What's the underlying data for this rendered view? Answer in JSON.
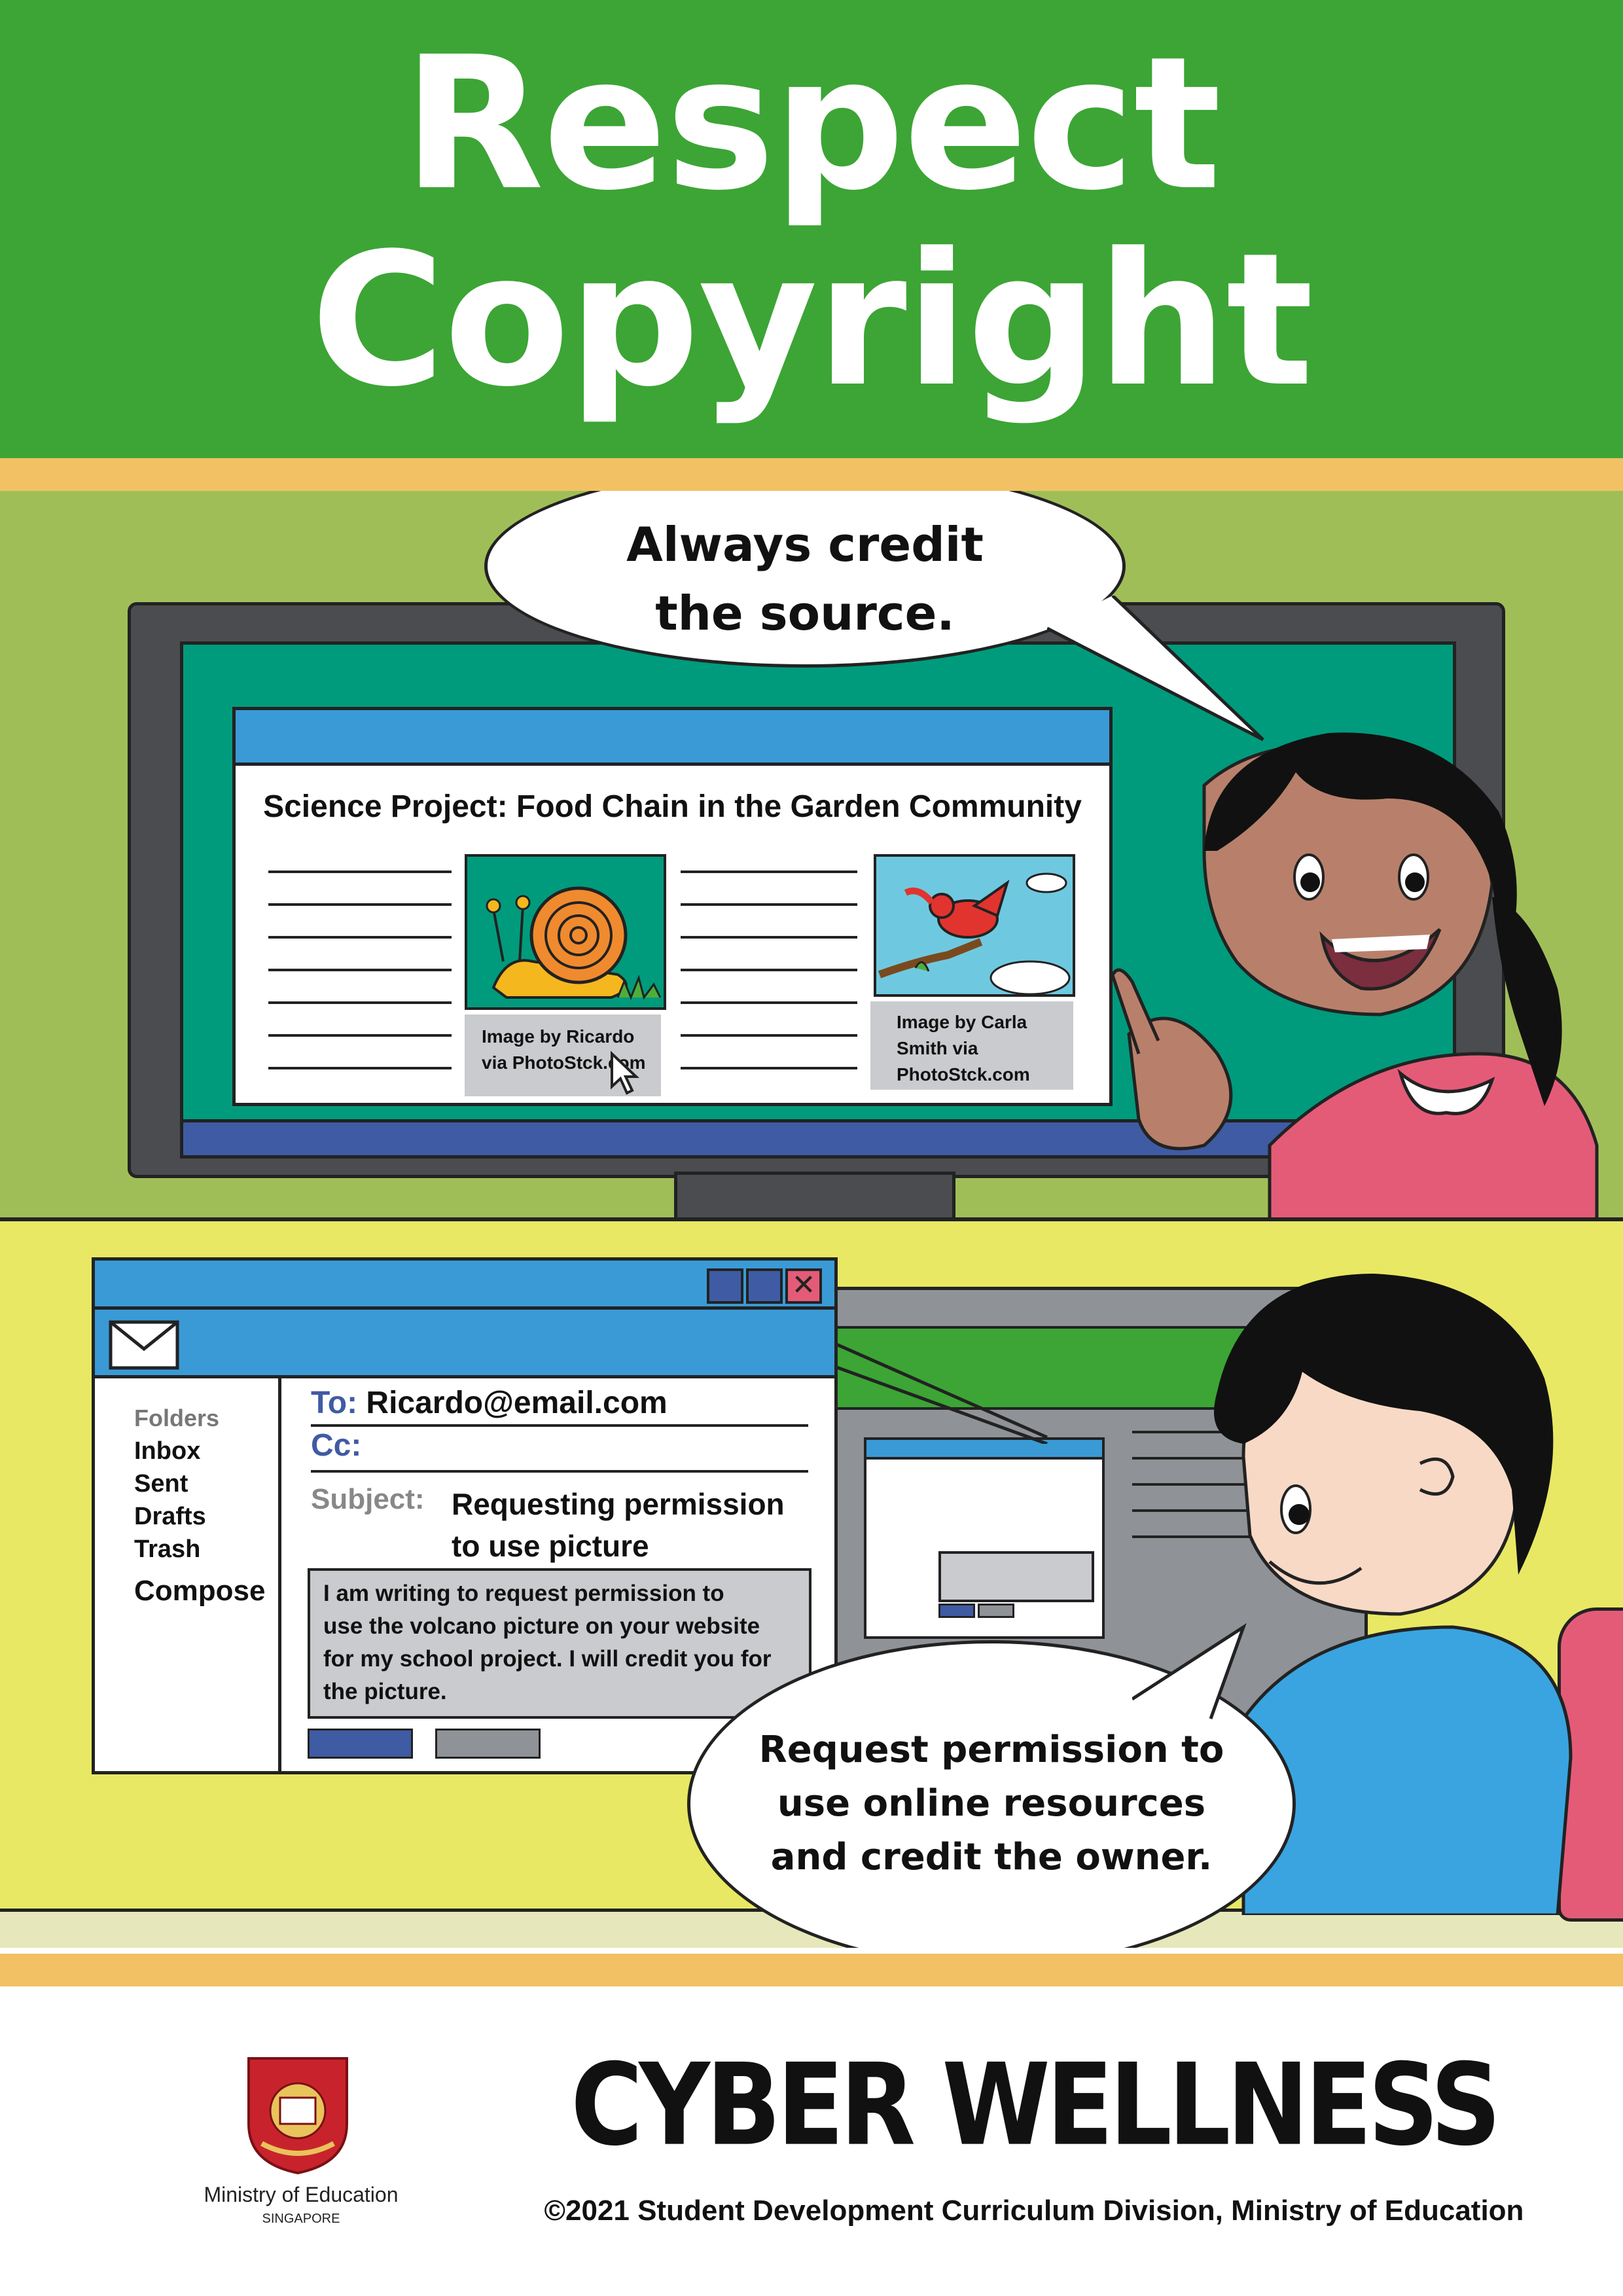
{
  "header": {
    "title_line1": "Respect",
    "title_line2": "Copyright"
  },
  "panel1": {
    "speech": [
      "Always credit",
      "the source."
    ],
    "document": {
      "title": "Science Project: Food Chain in the Garden Community",
      "captions": [
        [
          "Image by Ricardo",
          "via PhotoStck.com"
        ],
        [
          "Image by Carla",
          "Smith via",
          "PhotoStck.com"
        ]
      ]
    }
  },
  "panel2": {
    "email": {
      "folders_label": "Folders",
      "folders": [
        "Inbox",
        "Sent",
        "Drafts",
        "Trash"
      ],
      "compose": "Compose",
      "to_label": "To:",
      "to_value": "Ricardo@email.com",
      "cc_label": "Cc:",
      "subject_label": "Subject:",
      "subject_value": [
        "Requesting permission",
        "to use picture"
      ],
      "body": [
        "I am writing to request permission to",
        "use the volcano picture on your website",
        "for my school project. I will credit you for",
        "the picture."
      ]
    },
    "speech": [
      "Request permission to",
      "use online resources",
      "and credit the owner."
    ]
  },
  "footer": {
    "logo_text": "Ministry of Education",
    "logo_subtext": "SINGAPORE",
    "brand": "CYBER WELLNESS",
    "copyright": "©2021 Student Development Curriculum Division, Ministry of Education"
  },
  "colors": {
    "green": "#3ca535",
    "stripe": "#f2c164",
    "panel1_bg": "#a0be58",
    "panel2_bg": "#e8e864",
    "window_blue": "#3a9ad6"
  }
}
